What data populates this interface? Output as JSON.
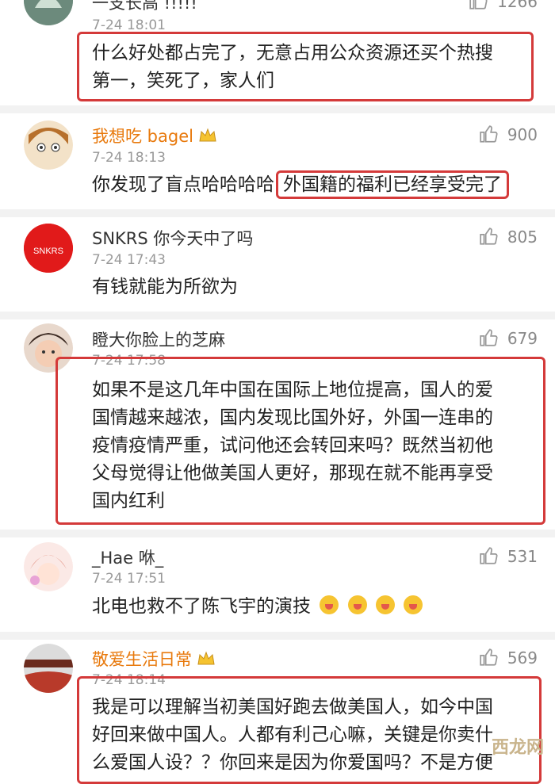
{
  "comments": [
    {
      "name": "一支长高 !!!!!",
      "time": "7-24 18:01",
      "likes": "1266",
      "lines": [
        "什么好处都占完了，无意占用公众资源还买个热搜",
        "第一，笑死了，家人们"
      ]
    },
    {
      "name": "我想吃 bagel",
      "time": "7-24 18:13",
      "likes": "900",
      "text_plain": "你发现了盲点哈哈哈哈",
      "text_hl": "外国籍的福利已经享受完了"
    },
    {
      "name": "SNKRS 你今天中了吗",
      "time": "7-24 17:43",
      "likes": "805",
      "avatar_text": "SNKRS",
      "text": "有钱就能为所欲为"
    },
    {
      "name": "瞪大你脸上的芝麻",
      "time": "7-24 17:58",
      "likes": "679",
      "lines": [
        "如果不是这几年中国在国际上地位提高，国人的爱",
        "国情越来越浓，国内发现比国外好，外国一连串的",
        "疫情疫情严重，试问他还会转回来吗？既然当初他",
        "父母觉得让他做美国人更好，那现在就不能再享受",
        "国内红利"
      ]
    },
    {
      "name": "_Hae 咻_",
      "time": "7-24 17:51",
      "likes": "531",
      "text": "北电也救不了陈飞宇的演技"
    },
    {
      "name": "敬爱生活日常",
      "time": "7-24 18:14",
      "likes": "569",
      "lines": [
        "我是可以理解当初美国好跑去做美国人，如今中国",
        "好回来做中国人。人都有利己心嘛，关键是你卖什",
        "么爱国人设？？你回来是因为你爱国吗？不是方便"
      ]
    }
  ],
  "watermark": "西龙网",
  "colors": {
    "highlight": "#d43a3a",
    "vip_name": "#e8790c"
  }
}
